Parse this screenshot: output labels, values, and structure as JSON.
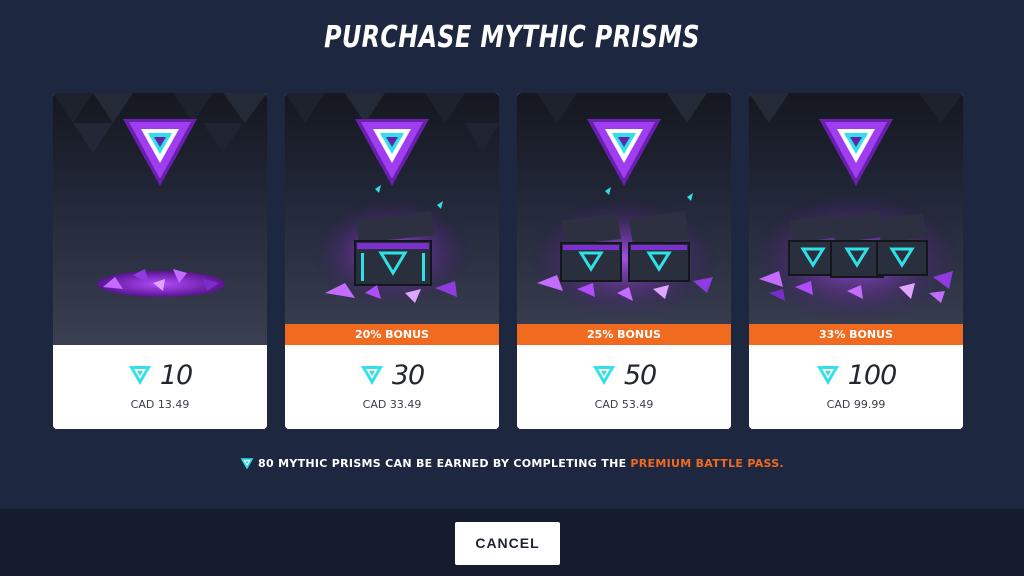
{
  "title": "PURCHASE MYTHIC PRISMS",
  "offers": [
    {
      "amount": "10",
      "price": "CAD 13.49",
      "bonus": "",
      "chests": 0
    },
    {
      "amount": "30",
      "price": "CAD 33.49",
      "bonus": "20% BONUS",
      "chests": 1
    },
    {
      "amount": "50",
      "price": "CAD 53.49",
      "bonus": "25% BONUS",
      "chests": 2
    },
    {
      "amount": "100",
      "price": "CAD 99.99",
      "bonus": "33% BONUS",
      "chests": 3
    }
  ],
  "note": {
    "text": "80 MYTHIC PRISMS CAN BE EARNED BY COMPLETING THE",
    "highlight": "PREMIUM BATTLE PASS."
  },
  "cancel_label": "CANCEL",
  "colors": {
    "background": "#1d2740",
    "footer": "#151c2d",
    "accent_orange": "#f06b20",
    "prism_cyan": "#2fe0e6",
    "prism_purple": "#8a2be2"
  },
  "icons": {
    "currency": "mythic-prism-icon",
    "hero_gem": "mythic-prism-gem-icon",
    "chest": "prism-chest-icon"
  }
}
